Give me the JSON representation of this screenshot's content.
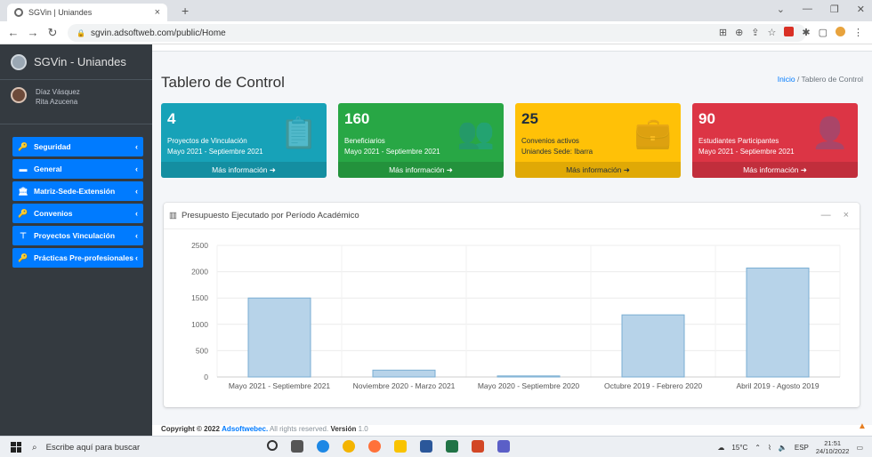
{
  "browser": {
    "tab_title": "SGVin | Uniandes",
    "url": "sgvin.adsoftweb.com/public/Home"
  },
  "sidebar": {
    "brand": "SGVin - Uniandes",
    "user_line1": "Díaz Vásquez",
    "user_line2": "Rita Azucena",
    "items": [
      {
        "label": "Seguridad",
        "icon": "key-icon"
      },
      {
        "label": "General",
        "icon": "folder-icon"
      },
      {
        "label": "Matriz-Sede-Extensión",
        "icon": "institution-icon"
      },
      {
        "label": "Convenios",
        "icon": "key-icon"
      },
      {
        "label": "Proyectos Vinculación",
        "icon": "sitemap-icon"
      },
      {
        "label": "Prácticas Pre-profesionales",
        "icon": "key-icon"
      }
    ]
  },
  "page": {
    "title": "Tablero de Control",
    "breadcrumb_home": "Inicio",
    "breadcrumb_sep": "/",
    "breadcrumb_current": "Tablero de Control"
  },
  "boxes": [
    {
      "value": "4",
      "line1": "Proyectos de Vinculación",
      "line2": "Mayo 2021 - Septiembre 2021",
      "footer": "Más información ➜",
      "color": "#17a2b8",
      "icon": "clipboard-icon"
    },
    {
      "value": "160",
      "line1": "Beneficiarios",
      "line2": "Mayo 2021 - Septiembre 2021",
      "footer": "Más información ➜",
      "color": "#28a745",
      "icon": "users-icon"
    },
    {
      "value": "25",
      "line1": "Convenios activos",
      "line2": "Uniandes Sede: Ibarra",
      "footer": "Más información ➜",
      "color": "#ffc107",
      "icon": "briefcase-icon"
    },
    {
      "value": "90",
      "line1": "Estudiantes Participantes",
      "line2": "Mayo 2021 - Septiembre 2021",
      "footer": "Más información ➜",
      "color": "#dc3545",
      "icon": "user-plus-icon"
    }
  ],
  "card": {
    "title": "Presupuesto Ejecutado por Período Académico",
    "collapse": "—",
    "close": "×"
  },
  "chart_data": {
    "type": "bar",
    "title": "Presupuesto Ejecutado por Período Académico",
    "categories": [
      "Mayo 2021 - Septiembre 2021",
      "Noviembre 2020 - Marzo 2021",
      "Mayo 2020 - Septiembre 2020",
      "Octubre 2019 - Febrero 2020",
      "Abril 2019 - Agosto 2019"
    ],
    "values": [
      1500,
      130,
      20,
      1180,
      2070
    ],
    "ylim": [
      0,
      2500
    ],
    "yticks": [
      0,
      500,
      1000,
      1500,
      2000,
      2500
    ],
    "grid": true,
    "bar_fill": "#b7d3e9",
    "bar_stroke": "#7aaed3"
  },
  "footer": {
    "copyright": "Copyright © 2022",
    "company": "Adsoftwebec.",
    "rights": "All rights reserved.",
    "version_label": "Versión",
    "version": "1.0"
  },
  "taskbar": {
    "search_placeholder": "Escribe aquí para buscar",
    "weather": "15°C",
    "lang": "ESP",
    "time": "21:51",
    "date": "24/10/2022"
  }
}
